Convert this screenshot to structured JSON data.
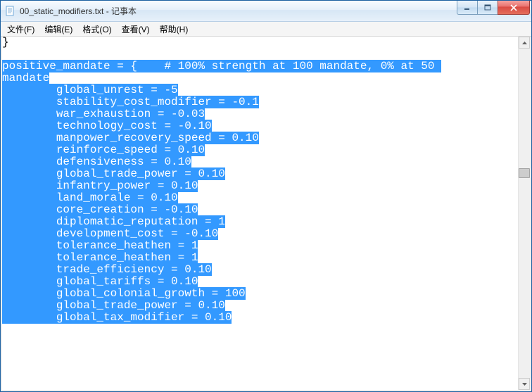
{
  "window": {
    "title": "00_static_modifiers.txt - 记事本"
  },
  "menu": {
    "file": "文件(F)",
    "edit": "编辑(E)",
    "format": "格式(O)",
    "view": "查看(V)",
    "help": "帮助(H)"
  },
  "editor": {
    "plain_line": "}",
    "sel_line1": "positive_mandate = {    # 100% strength at 100 mandate, 0% at 50 ",
    "sel_line2": "mandate",
    "indent": "        ",
    "entries": [
      "global_unrest = -5",
      "stability_cost_modifier = -0.1",
      "war_exhaustion = -0.03",
      "technology_cost = -0.10",
      "manpower_recovery_speed = 0.10",
      "reinforce_speed = 0.10",
      "defensiveness = 0.10",
      "global_trade_power = 0.10",
      "infantry_power = 0.10",
      "land_morale = 0.10",
      "core_creation = -0.10",
      "diplomatic_reputation = 1",
      "development_cost = -0.10",
      "tolerance_heathen = 1",
      "tolerance_heathen = 1",
      "trade_efficiency = 0.10",
      "global_tariffs = 0.10",
      "global_colonial_growth = 100",
      "global_trade_power = 0.10",
      "global_tax_modifier = 0.10"
    ]
  }
}
